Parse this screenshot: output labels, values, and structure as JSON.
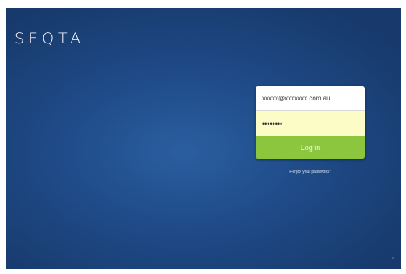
{
  "brand": {
    "logo_text": "SEQTA"
  },
  "login": {
    "username_value": "xxxxx@xxxxxxx.com.au",
    "password_value": "••••••••",
    "login_button_label": "Log in",
    "forgot_password_link": "Forgot your password?"
  },
  "colors": {
    "background": "#1f4b88",
    "login_button": "#8cc63e",
    "password_field_fill": "#fbfcc6",
    "logo": "#ffffff"
  }
}
